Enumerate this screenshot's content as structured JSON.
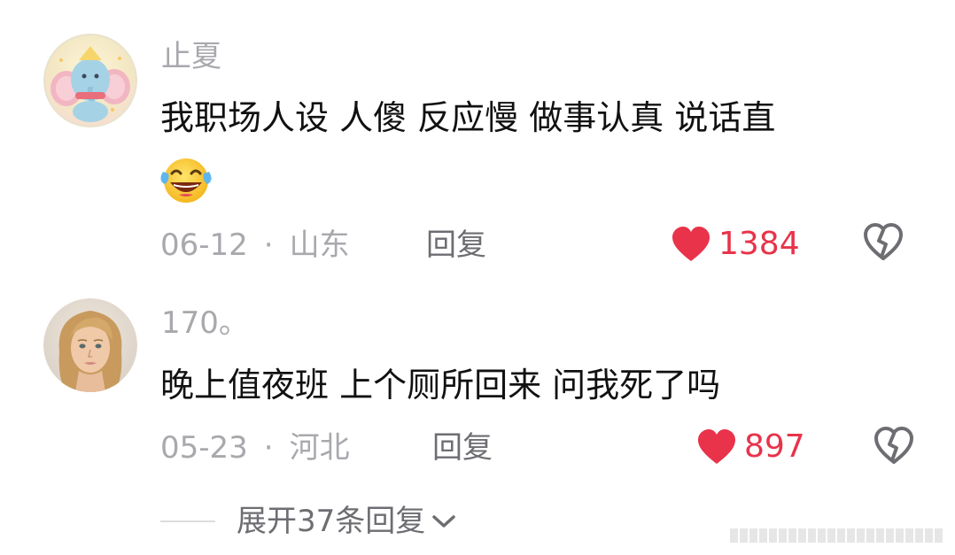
{
  "comments": [
    {
      "username": "止夏",
      "text": "我职场人设 人傻 反应慢 做事认真 说话直",
      "emoji_icon": "face-with-tears-of-joy-icon",
      "date": "06-12",
      "separator": "·",
      "location": "山东",
      "reply_label": "回复",
      "likes": "1384",
      "avatar": "cartoon-elephant-avatar"
    },
    {
      "username": "170。",
      "text": "晚上值夜班 上个厕所回来 问我死了吗",
      "date": "05-23",
      "separator": "·",
      "location": "河北",
      "reply_label": "回复",
      "likes": "897",
      "avatar": "woman-portrait-avatar"
    }
  ],
  "expand": {
    "label": "展开37条回复"
  },
  "colors": {
    "like": "#e8334a",
    "meta": "#a8a8ad",
    "text": "#111111"
  }
}
